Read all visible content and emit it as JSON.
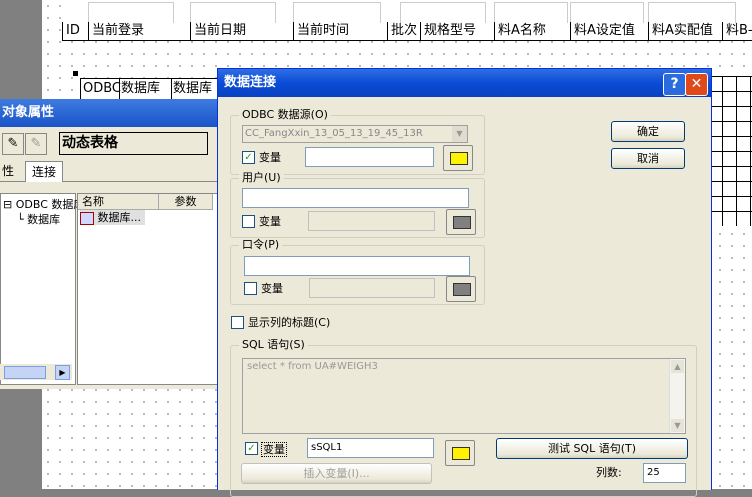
{
  "background_report": {
    "header_columns": [
      "ID",
      "当前登录",
      "当前日期",
      "当前时间",
      "批次",
      "规格型号",
      "料A名称",
      "料A设定值",
      "料A实配值",
      "料B-"
    ],
    "mini_table_cells": [
      "ODBC",
      "数据库",
      "数据库"
    ]
  },
  "properties_panel": {
    "title": "对象属性",
    "object_name": "动态表格",
    "tabs": [
      "性",
      "连接"
    ],
    "tree_items": [
      "ODBC 数据库",
      "数据库"
    ],
    "list_columns": [
      "名称",
      "参数"
    ],
    "list_rows": [
      {
        "name": "数据库...",
        "param": ""
      }
    ]
  },
  "dialog": {
    "title": "数据连接",
    "help_btn": "?",
    "close_btn": "✕",
    "ok_label": "确定",
    "cancel_label": "取消",
    "odbc_group_label": "ODBC 数据源(O)",
    "odbc_source_value": "CC_FangXxin_13_05_13_19_45_13R",
    "odbc_var_label": "变量",
    "odbc_var_checked": "✓",
    "odbc_var_value": "",
    "user_group_label": "用户(U)",
    "user_value": "",
    "user_var_label": "变量",
    "user_var_checked": "",
    "password_group_label": "口令(P)",
    "password_value": "",
    "password_var_label": "变量",
    "password_var_checked": "",
    "show_titles_label": "显示列的标题(C)",
    "show_titles_checked": "",
    "sql_group_label": "SQL 语句(S)",
    "sql_text": "select * from UA#WEIGH3",
    "sql_var_label": "变量",
    "sql_var_checked": "✓",
    "sql_var_value": "sSQL1",
    "test_sql_label": "测试 SQL 语句(T)",
    "insert_var_label": "插入变量(I)...",
    "columns_label": "列数:",
    "columns_value": "25"
  }
}
